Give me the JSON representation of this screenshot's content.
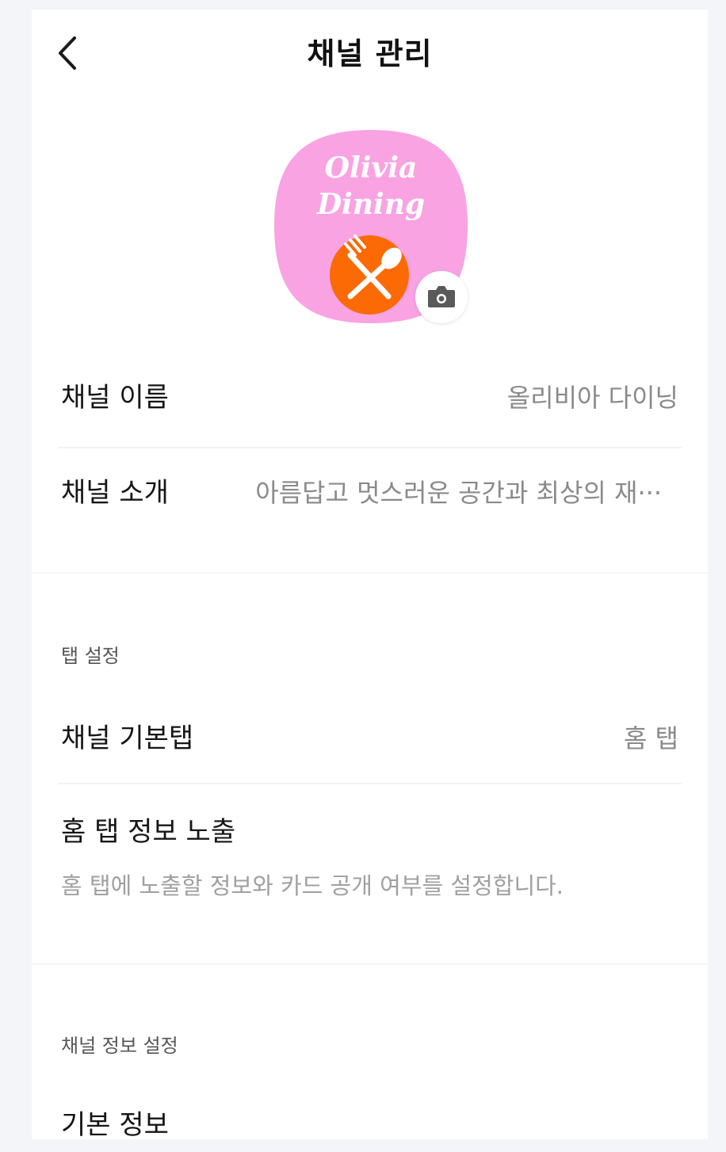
{
  "header": {
    "title": "채널 관리",
    "back_icon": "chevron-left-icon"
  },
  "profile": {
    "logo_text_line1": "Olivia",
    "logo_text_line2": "Dining",
    "logo_bg_color": "#f9a3e3",
    "logo_circle_color": "#fb6a04",
    "camera_icon": "camera-icon"
  },
  "channel_name": {
    "label": "채널 이름",
    "value": "올리비아 다이닝"
  },
  "channel_intro": {
    "label": "채널 소개",
    "value": "아름답고 멋스러운 공간과 최상의 재···"
  },
  "tab_settings": {
    "section_title": "탭 설정",
    "default_tab": {
      "label": "채널 기본탭",
      "value": "홈 탭"
    },
    "home_tab_info": {
      "label": "홈 탭 정보 노출",
      "description": "홈 탭에 노출할 정보와 카드 공개 여부를 설정합니다."
    }
  },
  "channel_info_settings": {
    "section_title": "채널 정보 설정",
    "basic_info_label": "기본 정보"
  }
}
